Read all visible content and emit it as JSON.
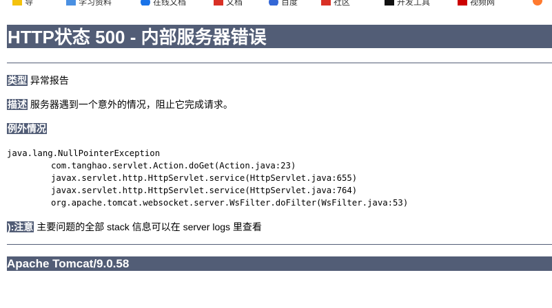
{
  "bookmarks": [
    {
      "icon": "star-icon",
      "color": "#f4c20d",
      "label": "导"
    },
    {
      "icon": "doc-icon",
      "color": "#4a90e2",
      "label": "学习资料"
    },
    {
      "icon": "globe-icon",
      "color": "#1a73e8",
      "label": "在线文档"
    },
    {
      "icon": "red-square-icon",
      "color": "#d93025",
      "label": "文档"
    },
    {
      "icon": "blue-circle-icon",
      "color": "#3367d6",
      "label": "百度"
    },
    {
      "icon": "red-square-icon",
      "color": "#d93025",
      "label": "社区"
    },
    {
      "icon": "black-square-icon",
      "color": "#111111",
      "label": "开发工具"
    },
    {
      "icon": "red-square-icon",
      "color": "#cc0000",
      "label": "视频网"
    },
    {
      "icon": "orange-circle-icon",
      "color": "#ff7a2f",
      "label": ""
    }
  ],
  "page": {
    "title": "HTTP状态 500 - 内部服务器错误",
    "type_label": "类型",
    "type_value": "异常报告",
    "desc_label": "描述",
    "desc_value": "服务器遇到一个意外的情况，阻止它完成请求。",
    "exception_label": "例外情况",
    "trace": [
      "java.lang.NullPointerException",
      "com.tanghao.servlet.Action.doGet(Action.java:23)",
      "javax.servlet.http.HttpServlet.service(HttpServlet.java:655)",
      "javax.servlet.http.HttpServlet.service(HttpServlet.java:764)",
      "org.apache.tomcat.websocket.server.WsFilter.doFilter(WsFilter.java:53)"
    ],
    "note_label": "):注意",
    "note_value": "主要问题的全部 stack 信息可以在 server logs 里查看",
    "footer": "Apache Tomcat/9.0.58"
  },
  "colors": {
    "header_bg": "#525d76",
    "header_text": "#ffffff"
  }
}
